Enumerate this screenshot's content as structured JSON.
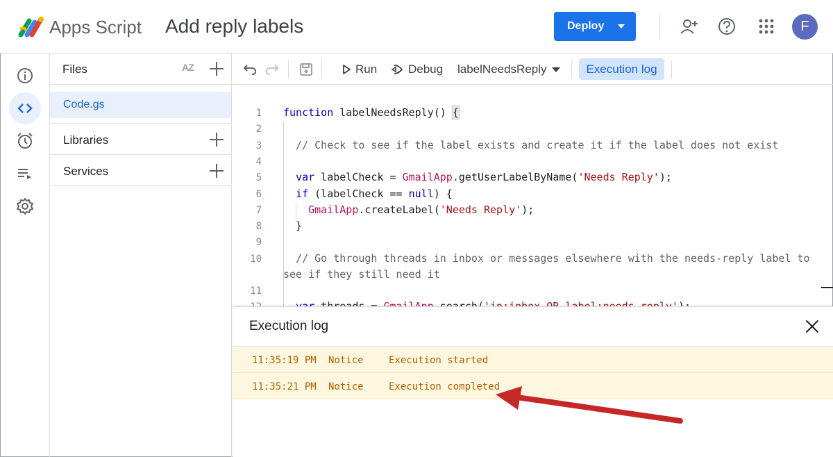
{
  "header": {
    "product": "Apps Script",
    "project_title": "Add reply labels",
    "deploy_label": "Deploy",
    "avatar_letter": "F",
    "icons": [
      "add-person-icon",
      "help-icon",
      "apps-grid-icon"
    ]
  },
  "rail": {
    "items": [
      "overview-icon",
      "editor-icon",
      "triggers-icon",
      "executions-icon",
      "settings-icon"
    ],
    "active": "editor-icon"
  },
  "files": {
    "title": "Files",
    "sort_label": "AZ",
    "items": [
      {
        "name": "Code.gs",
        "selected": true
      }
    ],
    "sections": [
      "Libraries",
      "Services"
    ]
  },
  "toolbar": {
    "run_label": "Run",
    "debug_label": "Debug",
    "function_select": "labelNeedsReply",
    "execution_log_label": "Execution log"
  },
  "editor": {
    "line_numbers": [
      "1",
      "2",
      "3",
      "4",
      "5",
      "6",
      "7",
      "8",
      "9",
      "10",
      "",
      "11",
      "12"
    ],
    "lines": [
      "function labelNeedsReply() {",
      "",
      "  // Check to see if the label exists and create it if the label does not exist",
      "",
      "  var labelCheck = GmailApp.getUserLabelByName('Needs Reply');",
      "  if (labelCheck == null) {",
      "    GmailApp.createLabel('Needs Reply');",
      "  }",
      "",
      "  // Go through threads in inbox or messages elsewhere with the needs-reply label to",
      "see if they still need it",
      "",
      "  var threads = GmailApp.search('in:inbox OR label:needs-reply');"
    ]
  },
  "log": {
    "title": "Execution log",
    "rows": [
      {
        "time": "11:35:19 PM",
        "level": "Notice",
        "message": "Execution started"
      },
      {
        "time": "11:35:21 PM",
        "level": "Notice",
        "message": "Execution completed"
      }
    ]
  },
  "colors": {
    "accent": "#1a73e8",
    "log_row_bg": "#fef7e0",
    "log_text": "#b06000",
    "annotation_arrow": "#c62828"
  }
}
